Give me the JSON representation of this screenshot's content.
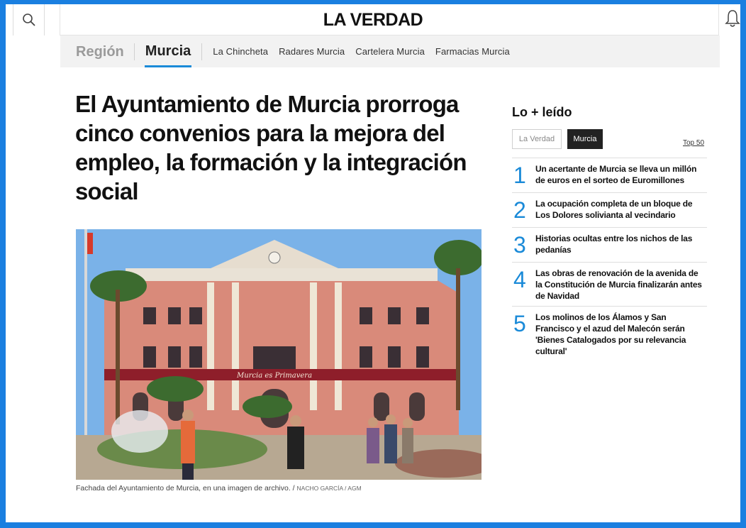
{
  "header": {
    "logo": "LA VERDAD",
    "search_icon": "search-icon",
    "bell_icon": "bell-icon"
  },
  "section_nav": {
    "region": "Región",
    "active": "Murcia",
    "links": [
      "La Chincheta",
      "Radares Murcia",
      "Cartelera Murcia",
      "Farmacias Murcia"
    ],
    "accent": "#1a8ad8"
  },
  "article": {
    "headline": "El Ayuntamiento de Murcia prorroga cinco convenios para la mejora del empleo, la formación y la integración social",
    "image_text": "Murcia es Primavera",
    "caption": "Fachada del Ayuntamiento de Murcia, en una imagen de archivo. /",
    "credit": "NACHO GARCÍA / AGM"
  },
  "sidebar": {
    "title": "Lo + leído",
    "tabs": [
      "La Verdad",
      "Murcia"
    ],
    "active_tab": "Murcia",
    "top_link": "Top 50",
    "items": [
      {
        "num": "1",
        "text": "Un acertante de Murcia se lleva un millón de euros en el sorteo de Euromillones"
      },
      {
        "num": "2",
        "text": "La ocupación completa de un bloque de Los Dolores solivianta al vecindario"
      },
      {
        "num": "3",
        "text": "Historias ocultas entre los nichos de las pedanías"
      },
      {
        "num": "4",
        "text": "Las obras de renovación de la avenida de la Constitución de Murcia finalizarán antes de Navidad"
      },
      {
        "num": "5",
        "text": "Los molinos de los Álamos y San Francisco y el azud del Malecón serán 'Bienes Catalogados por su relevancia cultural'"
      }
    ]
  }
}
